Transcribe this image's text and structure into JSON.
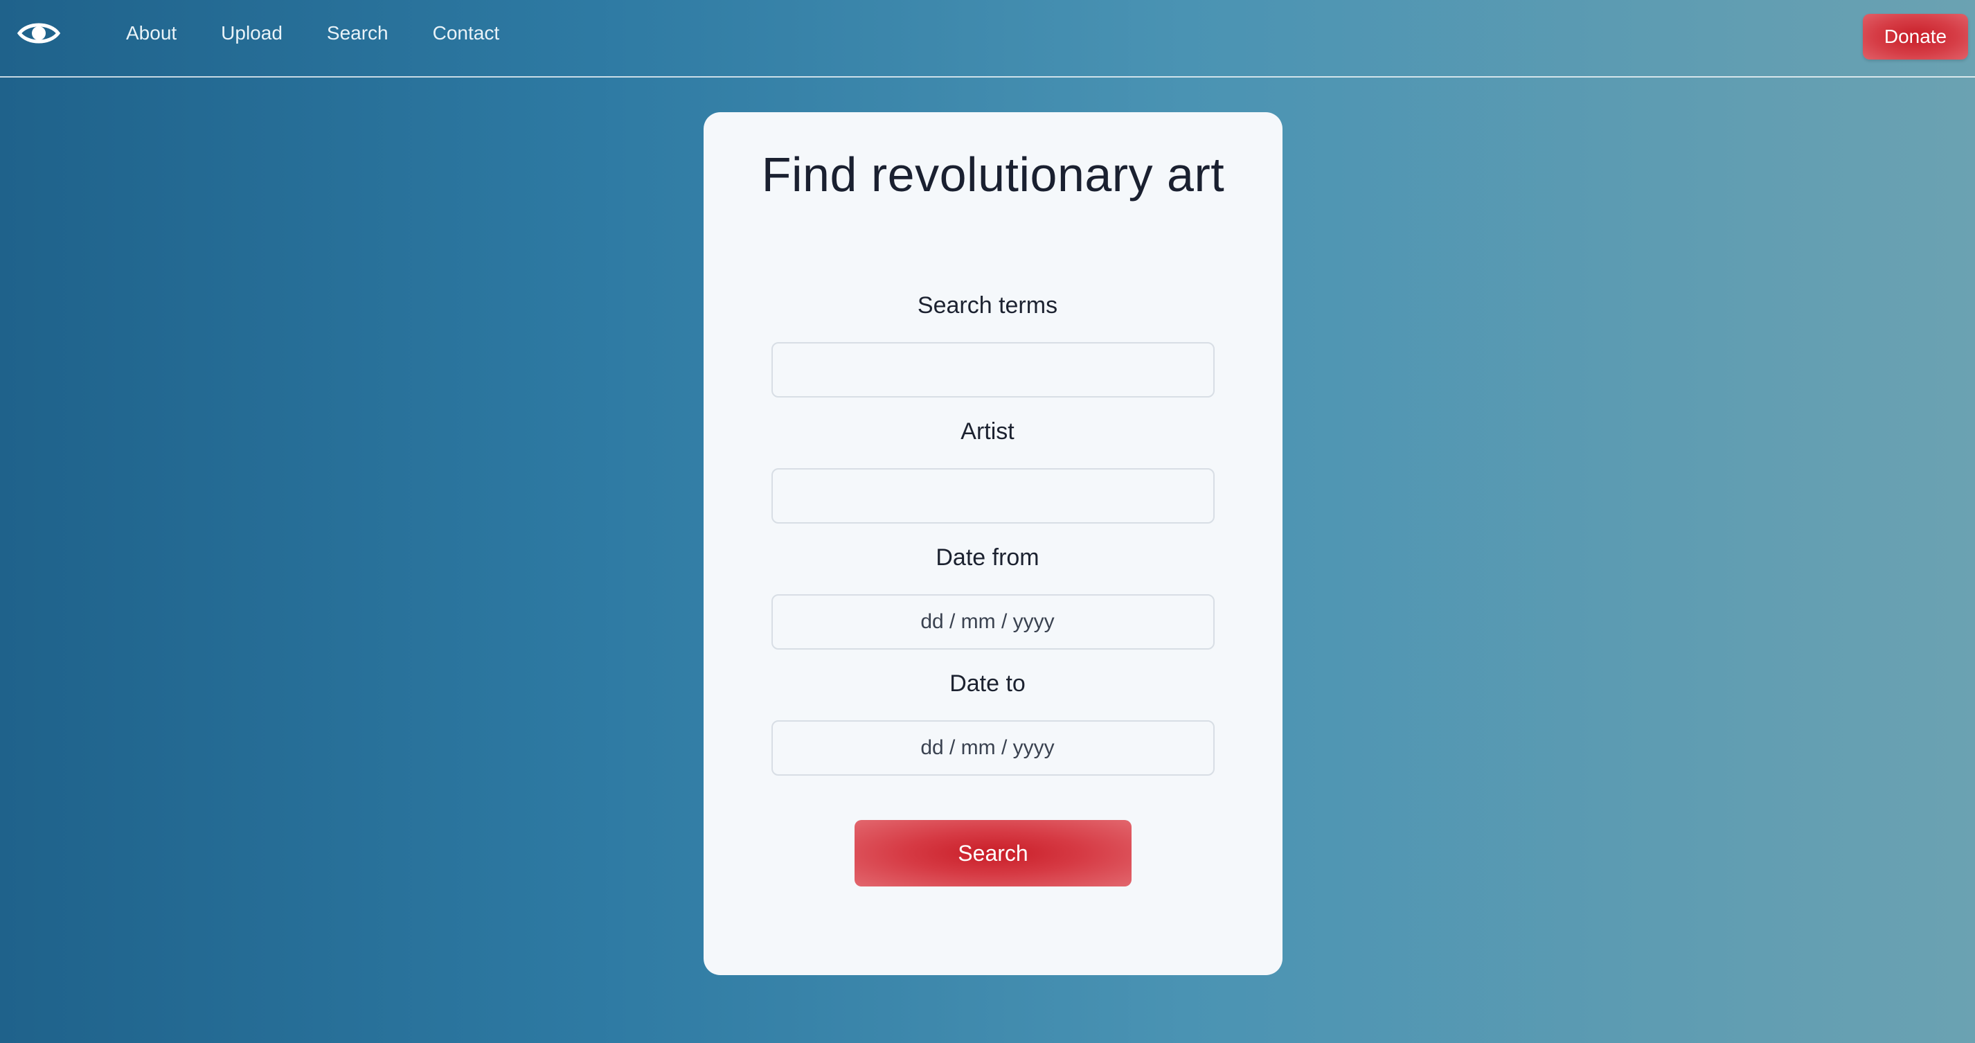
{
  "colors": {
    "accent": "#d32f38",
    "background_start": "#1f628b",
    "background_end": "#6ba2b2",
    "card": "#f5f8fb"
  },
  "nav": {
    "logo_icon": "eye-icon",
    "links": [
      {
        "label": "About"
      },
      {
        "label": "Upload"
      },
      {
        "label": "Search"
      },
      {
        "label": "Contact"
      }
    ],
    "donate_label": "Donate"
  },
  "search_form": {
    "title": "Find revolutionary art",
    "fields": {
      "terms": {
        "label": "Search terms",
        "value": ""
      },
      "artist": {
        "label": "Artist",
        "value": ""
      },
      "date_from": {
        "label": "Date from",
        "placeholder": "dd / mm / yyyy"
      },
      "date_to": {
        "label": "Date to",
        "placeholder": "dd / mm / yyyy"
      }
    },
    "submit_label": "Search"
  }
}
